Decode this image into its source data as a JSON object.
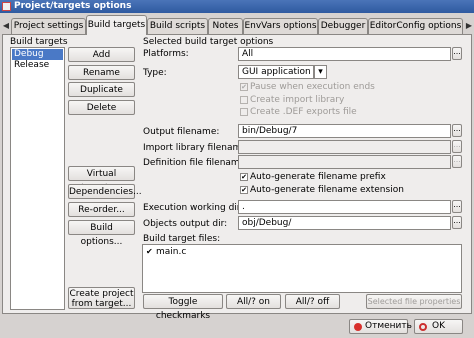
{
  "window": {
    "title": "Project/targets options"
  },
  "tabs": {
    "scroll_left": "◀",
    "scroll_right": "▶",
    "items": [
      {
        "label": "Project settings"
      },
      {
        "label": "Build targets"
      },
      {
        "label": "Build scripts"
      },
      {
        "label": "Notes"
      },
      {
        "label": "EnvVars options"
      },
      {
        "label": "Debugger"
      },
      {
        "label": "EditorConfig options"
      }
    ],
    "active": "Build targets"
  },
  "targets": {
    "header": "Build targets",
    "items": [
      "Debug",
      "Release"
    ],
    "selected": "Debug",
    "buttons": {
      "add": "Add",
      "rename": "Rename",
      "duplicate": "Duplicate",
      "delete": "Delete",
      "virtual": "Virtual targets...",
      "dependencies": "Dependencies...",
      "reorder": "Re-order...",
      "build_options": "Build options...",
      "create_project_1": "Create project",
      "create_project_2": "from target..."
    }
  },
  "options": {
    "header": "Selected build target options",
    "platforms_label": "Platforms:",
    "platforms_value": "All",
    "type_label": "Type:",
    "type_value": "GUI application",
    "pause_label": "Pause when execution ends",
    "pause_checked": true,
    "import_lib_label": "Create import library",
    "import_lib_checked": false,
    "def_label": "Create .DEF exports file",
    "def_checked": false,
    "output_label": "Output filename:",
    "output_value": "bin/Debug/7",
    "import_filename_label": "Import library filename:",
    "import_filename_value": "",
    "def_filename_label": "Definition file filename:",
    "def_filename_value": "",
    "auto_prefix_label": "Auto-generate filename prefix",
    "auto_prefix_checked": true,
    "auto_ext_label": "Auto-generate filename extension",
    "auto_ext_checked": true,
    "exec_dir_label": "Execution working dir:",
    "exec_dir_value": ".",
    "objects_dir_label": "Objects output dir:",
    "objects_dir_value": "obj/Debug/",
    "browse_label": "...",
    "check_mark": "✔",
    "dropdown_arrow": "▾"
  },
  "files": {
    "header": "Build target files:",
    "items": [
      {
        "name": "main.c",
        "checked": true
      }
    ],
    "buttons": {
      "toggle": "Toggle checkmarks",
      "all_on": "All/? on",
      "all_off": "All/? off",
      "properties": "Selected file properties"
    }
  },
  "dialog": {
    "cancel": "Отменить",
    "ok": "OK",
    "accent_cancel": "#d8302c"
  }
}
